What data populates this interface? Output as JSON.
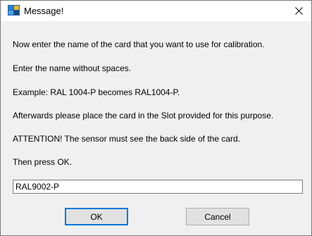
{
  "window": {
    "title": "Message!",
    "app_icon": "app-icon",
    "close_icon": "close-icon"
  },
  "message": {
    "lines": [
      "Now enter the name of the card that you want to use for calibration.",
      "Enter the name without spaces.",
      "Example: RAL 1004-P becomes RAL1004-P.",
      "Afterwards please place the card in the Slot provided for this purpose.",
      "ATTENTION! The sensor must see the back side of the card.",
      "Then press OK."
    ]
  },
  "input": {
    "value": "RAL9002-P"
  },
  "buttons": {
    "ok_label": "OK",
    "cancel_label": "Cancel"
  },
  "colors": {
    "dialog_background": "#f0f0f0",
    "titlebar_background": "#ffffff",
    "focus_border": "#0078d7"
  }
}
